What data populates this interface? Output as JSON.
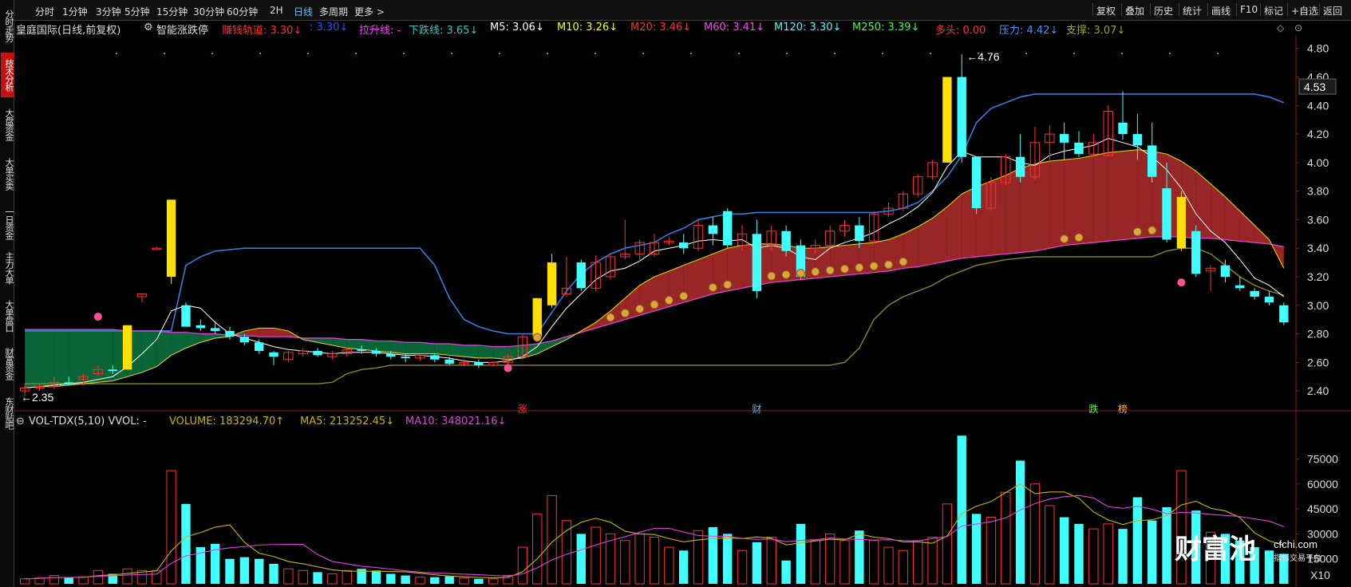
{
  "sidebar": {
    "tabs": [
      {
        "label": "分时走势",
        "active": false
      },
      {
        "label": "技术分析",
        "active": true
      },
      {
        "label": "大盘资金",
        "active": false
      },
      {
        "label": "大单买卖",
        "active": false
      },
      {
        "label": "一日资金",
        "active": false
      },
      {
        "label": "主力大单",
        "active": false
      },
      {
        "label": "大单盘口",
        "active": false
      },
      {
        "label": "财富资金",
        "active": false
      },
      {
        "label": "东财贴吧",
        "active": false
      }
    ]
  },
  "toolbar": {
    "periods": [
      "分时",
      "1分钟",
      "3分钟",
      "5分钟",
      "15分钟",
      "30分钟",
      "60分钟",
      "2H",
      "日线",
      "多周期",
      "更多 >"
    ],
    "active_period": "日线",
    "right_buttons": [
      "复权",
      "叠加",
      "历史",
      "统计",
      "画线",
      "F10",
      "标记",
      "+自选",
      "返回"
    ]
  },
  "main_legend": {
    "title": "皇庭国际(日线,前复权)",
    "indicator": "智能涨跌停",
    "items": [
      {
        "text": "赚钱轨道: 3.30↓",
        "color": "#ff3030"
      },
      {
        "text": ": 3.30↓",
        "color": "#3050ff"
      },
      {
        "text": "拉升线: -",
        "color": "#ff40ff"
      },
      {
        "text": "下跌线: 3.65↓",
        "color": "#40c0c0"
      },
      {
        "text": "M5: 3.06↓",
        "color": "#ffffff"
      },
      {
        "text": "M10: 3.26↓",
        "color": "#ffff00"
      },
      {
        "text": "M20: 3.46↓",
        "color": "#ff3030"
      },
      {
        "text": "M60: 3.41↓",
        "color": "#ff40ff"
      },
      {
        "text": "M120: 3.30↓",
        "color": "#40ffff"
      },
      {
        "text": "M250: 3.39↓",
        "color": "#40ff40"
      },
      {
        "text": "多头: 0.00",
        "color": "#ff3030"
      },
      {
        "text": "压力: 4.42↓",
        "color": "#4a90ff"
      },
      {
        "text": "支撑: 3.07↓",
        "color": "#a0a020"
      }
    ]
  },
  "price_axis": {
    "ticks": [
      "4.80",
      "4.60",
      "4.40",
      "4.20",
      "4.00",
      "3.80",
      "3.60",
      "3.40",
      "3.20",
      "3.00",
      "2.80",
      "2.60",
      "2.40"
    ],
    "current_price": "4.53",
    "high_label": "4.76",
    "low_label": "2.35"
  },
  "markers": {
    "up": "涨",
    "cai": "财",
    "down": "跌",
    "bang": "榜"
  },
  "volume_legend": {
    "title": "VOL-TDX(5,10) VVOL: -",
    "volume": "VOLUME: 183294.70↑",
    "ma5": "MA5: 213252.45↓",
    "ma10": "MA10: 348021.16↓"
  },
  "volume_axis": {
    "ticks": [
      "75000",
      "60000",
      "45000",
      "30000",
      "15000"
    ],
    "unit": "X10"
  },
  "watermark": {
    "brand": "财富池",
    "site": "cfchi.com",
    "tagline": "指标交易平台"
  },
  "colors": {
    "up": "#ff3030",
    "down": "#40ffff",
    "ribbon_up": "#a02828",
    "ribbon_down": "#0a6a3a",
    "resistance": "#3a7ae0",
    "support": "#8a8a20"
  },
  "chart_data": {
    "type": "candlestick",
    "candles": [
      {
        "o": 2.4,
        "h": 2.45,
        "l": 2.36,
        "c": 2.42,
        "v": 3000
      },
      {
        "o": 2.42,
        "h": 2.46,
        "l": 2.4,
        "c": 2.43,
        "v": 3500
      },
      {
        "o": 2.43,
        "h": 2.5,
        "l": 2.41,
        "c": 2.46,
        "v": 5000
      },
      {
        "o": 2.46,
        "h": 2.5,
        "l": 2.44,
        "c": 2.45,
        "v": 3800
      },
      {
        "o": 2.48,
        "h": 2.52,
        "l": 2.44,
        "c": 2.5,
        "v": 4200
      },
      {
        "o": 2.52,
        "h": 2.58,
        "l": 2.5,
        "c": 2.55,
        "v": 8000
      },
      {
        "o": 2.55,
        "h": 2.58,
        "l": 2.52,
        "c": 2.54,
        "v": 6000
      },
      {
        "o": 2.55,
        "h": 2.86,
        "l": 2.55,
        "c": 2.86,
        "v": 9000
      },
      {
        "o": 3.06,
        "h": 3.08,
        "l": 3.02,
        "c": 3.08,
        "v": 8000
      },
      {
        "o": 3.4,
        "h": 3.41,
        "l": 3.39,
        "c": 3.4,
        "v": 8000
      },
      {
        "o": 3.2,
        "h": 3.74,
        "l": 3.15,
        "c": 3.74,
        "v": 68000
      },
      {
        "o": 3.0,
        "h": 3.02,
        "l": 2.85,
        "c": 2.85,
        "v": 48000
      },
      {
        "o": 2.86,
        "h": 2.9,
        "l": 2.82,
        "c": 2.84,
        "v": 22000
      },
      {
        "o": 2.84,
        "h": 2.88,
        "l": 2.8,
        "c": 2.82,
        "v": 24000
      },
      {
        "o": 2.82,
        "h": 2.85,
        "l": 2.76,
        "c": 2.78,
        "v": 15000
      },
      {
        "o": 2.78,
        "h": 2.8,
        "l": 2.72,
        "c": 2.74,
        "v": 16000
      },
      {
        "o": 2.74,
        "h": 2.76,
        "l": 2.66,
        "c": 2.68,
        "v": 15000
      },
      {
        "o": 2.67,
        "h": 2.68,
        "l": 2.58,
        "c": 2.64,
        "v": 12000
      },
      {
        "o": 2.62,
        "h": 2.68,
        "l": 2.6,
        "c": 2.67,
        "v": 9000
      },
      {
        "o": 2.66,
        "h": 2.7,
        "l": 2.64,
        "c": 2.68,
        "v": 8000
      },
      {
        "o": 2.68,
        "h": 2.7,
        "l": 2.64,
        "c": 2.65,
        "v": 7000
      },
      {
        "o": 2.64,
        "h": 2.68,
        "l": 2.62,
        "c": 2.66,
        "v": 6000
      },
      {
        "o": 2.66,
        "h": 2.7,
        "l": 2.64,
        "c": 2.69,
        "v": 8000
      },
      {
        "o": 2.69,
        "h": 2.72,
        "l": 2.66,
        "c": 2.68,
        "v": 9000
      },
      {
        "o": 2.68,
        "h": 2.7,
        "l": 2.64,
        "c": 2.66,
        "v": 8000
      },
      {
        "o": 2.66,
        "h": 2.68,
        "l": 2.62,
        "c": 2.64,
        "v": 6000
      },
      {
        "o": 2.64,
        "h": 2.66,
        "l": 2.6,
        "c": 2.63,
        "v": 5000
      },
      {
        "o": 2.63,
        "h": 2.66,
        "l": 2.61,
        "c": 2.65,
        "v": 4000
      },
      {
        "o": 2.65,
        "h": 2.66,
        "l": 2.6,
        "c": 2.62,
        "v": 4000
      },
      {
        "o": 2.62,
        "h": 2.64,
        "l": 2.58,
        "c": 2.59,
        "v": 4500
      },
      {
        "o": 2.59,
        "h": 2.62,
        "l": 2.57,
        "c": 2.6,
        "v": 3500
      },
      {
        "o": 2.6,
        "h": 2.62,
        "l": 2.56,
        "c": 2.58,
        "v": 3000
      },
      {
        "o": 2.58,
        "h": 2.61,
        "l": 2.57,
        "c": 2.6,
        "v": 3000
      },
      {
        "o": 2.6,
        "h": 2.66,
        "l": 2.58,
        "c": 2.64,
        "v": 5000
      },
      {
        "o": 2.64,
        "h": 2.8,
        "l": 2.62,
        "c": 2.78,
        "v": 22000
      },
      {
        "o": 2.78,
        "h": 3.05,
        "l": 2.76,
        "c": 3.05,
        "v": 42000
      },
      {
        "o": 3.0,
        "h": 3.36,
        "l": 2.98,
        "c": 3.3,
        "v": 53000
      },
      {
        "o": 3.08,
        "h": 3.34,
        "l": 3.06,
        "c": 3.12,
        "v": 38000
      },
      {
        "o": 3.3,
        "h": 3.32,
        "l": 3.1,
        "c": 3.12,
        "v": 30000
      },
      {
        "o": 3.12,
        "h": 3.35,
        "l": 3.1,
        "c": 3.3,
        "v": 34000
      },
      {
        "o": 3.2,
        "h": 3.36,
        "l": 3.18,
        "c": 3.34,
        "v": 30000
      },
      {
        "o": 3.34,
        "h": 3.6,
        "l": 3.32,
        "c": 3.36,
        "v": 26000
      },
      {
        "o": 3.36,
        "h": 3.46,
        "l": 3.3,
        "c": 3.44,
        "v": 30000
      },
      {
        "o": 3.36,
        "h": 3.5,
        "l": 3.34,
        "c": 3.44,
        "v": 28000
      },
      {
        "o": 3.44,
        "h": 3.48,
        "l": 3.42,
        "c": 3.45,
        "v": 22000
      },
      {
        "o": 3.44,
        "h": 3.5,
        "l": 3.36,
        "c": 3.4,
        "v": 20000
      },
      {
        "o": 3.4,
        "h": 3.6,
        "l": 3.38,
        "c": 3.56,
        "v": 32000
      },
      {
        "o": 3.56,
        "h": 3.62,
        "l": 3.42,
        "c": 3.5,
        "v": 34000
      },
      {
        "o": 3.66,
        "h": 3.68,
        "l": 3.4,
        "c": 3.42,
        "v": 30000
      },
      {
        "o": 3.42,
        "h": 3.56,
        "l": 3.38,
        "c": 3.5,
        "v": 20000
      },
      {
        "o": 3.5,
        "h": 3.6,
        "l": 3.05,
        "c": 3.1,
        "v": 25000
      },
      {
        "o": 3.42,
        "h": 3.56,
        "l": 3.38,
        "c": 3.52,
        "v": 28000
      },
      {
        "o": 3.52,
        "h": 3.56,
        "l": 3.34,
        "c": 3.38,
        "v": 14000
      },
      {
        "o": 3.42,
        "h": 3.46,
        "l": 3.18,
        "c": 3.2,
        "v": 36000
      },
      {
        "o": 3.4,
        "h": 3.46,
        "l": 3.36,
        "c": 3.42,
        "v": 26000
      },
      {
        "o": 3.42,
        "h": 3.56,
        "l": 3.4,
        "c": 3.52,
        "v": 30000
      },
      {
        "o": 3.52,
        "h": 3.6,
        "l": 3.48,
        "c": 3.56,
        "v": 26000
      },
      {
        "o": 3.56,
        "h": 3.62,
        "l": 3.4,
        "c": 3.45,
        "v": 32000
      },
      {
        "o": 3.45,
        "h": 3.66,
        "l": 3.44,
        "c": 3.64,
        "v": 26000
      },
      {
        "o": 3.64,
        "h": 3.72,
        "l": 3.62,
        "c": 3.68,
        "v": 22000
      },
      {
        "o": 3.68,
        "h": 3.8,
        "l": 3.66,
        "c": 3.78,
        "v": 20000
      },
      {
        "o": 3.78,
        "h": 3.92,
        "l": 3.76,
        "c": 3.9,
        "v": 26000
      },
      {
        "o": 3.9,
        "h": 4.02,
        "l": 3.88,
        "c": 4.0,
        "v": 28000
      },
      {
        "o": 4.0,
        "h": 4.6,
        "l": 4.0,
        "c": 4.6,
        "v": 48000
      },
      {
        "o": 4.6,
        "h": 4.76,
        "l": 4.0,
        "c": 4.04,
        "v": 89000
      },
      {
        "o": 4.04,
        "h": 4.04,
        "l": 3.64,
        "c": 3.68,
        "v": 42000
      },
      {
        "o": 3.68,
        "h": 3.9,
        "l": 3.66,
        "c": 3.86,
        "v": 40000
      },
      {
        "o": 3.86,
        "h": 4.06,
        "l": 3.84,
        "c": 4.04,
        "v": 55000
      },
      {
        "o": 4.04,
        "h": 4.2,
        "l": 3.86,
        "c": 3.9,
        "v": 74000
      },
      {
        "o": 3.9,
        "h": 4.25,
        "l": 3.88,
        "c": 4.14,
        "v": 60000
      },
      {
        "o": 4.14,
        "h": 4.26,
        "l": 4.0,
        "c": 4.2,
        "v": 47000
      },
      {
        "o": 4.2,
        "h": 4.28,
        "l": 4.02,
        "c": 4.14,
        "v": 40000
      },
      {
        "o": 4.14,
        "h": 4.22,
        "l": 4.04,
        "c": 4.06,
        "v": 36000
      },
      {
        "o": 4.06,
        "h": 4.2,
        "l": 4.04,
        "c": 4.14,
        "v": 33000
      },
      {
        "o": 4.05,
        "h": 4.4,
        "l": 4.04,
        "c": 4.36,
        "v": 36000
      },
      {
        "o": 4.28,
        "h": 4.5,
        "l": 4.16,
        "c": 4.2,
        "v": 33000
      },
      {
        "o": 4.2,
        "h": 4.34,
        "l": 4.02,
        "c": 4.12,
        "v": 52000
      },
      {
        "o": 4.12,
        "h": 4.28,
        "l": 3.86,
        "c": 3.9,
        "v": 38000
      },
      {
        "o": 3.82,
        "h": 4.0,
        "l": 3.44,
        "c": 3.46,
        "v": 46000
      },
      {
        "o": 3.4,
        "h": 3.8,
        "l": 3.38,
        "c": 3.76,
        "v": 68000
      },
      {
        "o": 3.52,
        "h": 3.56,
        "l": 3.2,
        "c": 3.22,
        "v": 44000
      },
      {
        "o": 3.24,
        "h": 3.28,
        "l": 3.1,
        "c": 3.26,
        "v": 31000
      },
      {
        "o": 3.28,
        "h": 3.32,
        "l": 3.16,
        "c": 3.2,
        "v": 30000
      },
      {
        "o": 3.14,
        "h": 3.2,
        "l": 3.1,
        "c": 3.12,
        "v": 26000
      },
      {
        "o": 3.1,
        "h": 3.12,
        "l": 3.04,
        "c": 3.06,
        "v": 22000
      },
      {
        "o": 3.06,
        "h": 3.1,
        "l": 3.0,
        "c": 3.02,
        "v": 20000
      },
      {
        "o": 3.0,
        "h": 3.02,
        "l": 2.86,
        "c": 2.88,
        "v": 18000
      }
    ],
    "ylim": [
      2.3,
      4.86
    ],
    "vol_ylim": [
      0,
      92000
    ],
    "moving_averages": {
      "m5": [
        2.42,
        2.43,
        2.44,
        2.45,
        2.46,
        2.48,
        2.5,
        2.57,
        2.66,
        2.76,
        2.96,
        3.0,
        2.98,
        2.88,
        2.8,
        2.77,
        2.74,
        2.71,
        2.69,
        2.68,
        2.67,
        2.66,
        2.67,
        2.67,
        2.67,
        2.66,
        2.65,
        2.65,
        2.64,
        2.63,
        2.61,
        2.6,
        2.6,
        2.61,
        2.64,
        2.71,
        2.85,
        2.98,
        3.08,
        3.18,
        3.24,
        3.26,
        3.31,
        3.38,
        3.4,
        3.42,
        3.45,
        3.46,
        3.45,
        3.46,
        3.4,
        3.42,
        3.4,
        3.34,
        3.32,
        3.4,
        3.44,
        3.47,
        3.51,
        3.57,
        3.62,
        3.69,
        3.79,
        3.97,
        4.08,
        4.04,
        4.04,
        4.04,
        4.0,
        3.98,
        4.05,
        4.08,
        4.1,
        4.12,
        4.17,
        4.14,
        4.11,
        4.04,
        3.95,
        3.82,
        3.64,
        3.52,
        3.44,
        3.32,
        3.19,
        3.14,
        3.06
      ],
      "m10": [
        2.42,
        2.43,
        2.43,
        2.44,
        2.45,
        2.46,
        2.47,
        2.5,
        2.53,
        2.57,
        2.65,
        2.7,
        2.74,
        2.77,
        2.78,
        2.82,
        2.84,
        2.84,
        2.82,
        2.76,
        2.74,
        2.72,
        2.7,
        2.69,
        2.68,
        2.67,
        2.66,
        2.66,
        2.66,
        2.65,
        2.64,
        2.63,
        2.63,
        2.62,
        2.63,
        2.66,
        2.71,
        2.76,
        2.82,
        2.88,
        2.96,
        3.05,
        3.14,
        3.2,
        3.24,
        3.28,
        3.32,
        3.36,
        3.4,
        3.42,
        3.43,
        3.43,
        3.42,
        3.4,
        3.4,
        3.41,
        3.42,
        3.43,
        3.44,
        3.46,
        3.5,
        3.55,
        3.61,
        3.69,
        3.78,
        3.83,
        3.87,
        3.91,
        3.96,
        3.99,
        4.01,
        4.02,
        4.03,
        4.05,
        4.07,
        4.08,
        4.09,
        4.08,
        4.06,
        4.01,
        3.94,
        3.85,
        3.76,
        3.66,
        3.56,
        3.46,
        3.26
      ],
      "m60": [
        2.83,
        2.83,
        2.83,
        2.83,
        2.83,
        2.83,
        2.83,
        2.82,
        2.82,
        2.82,
        2.81,
        2.81,
        2.8,
        2.8,
        2.79,
        2.79,
        2.78,
        2.78,
        2.78,
        2.77,
        2.77,
        2.77,
        2.76,
        2.76,
        2.75,
        2.75,
        2.74,
        2.74,
        2.73,
        2.73,
        2.72,
        2.72,
        2.71,
        2.71,
        2.72,
        2.73,
        2.75,
        2.78,
        2.81,
        2.84,
        2.87,
        2.9,
        2.93,
        2.96,
        2.99,
        3.02,
        3.05,
        3.08,
        3.1,
        3.12,
        3.14,
        3.16,
        3.17,
        3.18,
        3.19,
        3.2,
        3.21,
        3.22,
        3.23,
        3.24,
        3.26,
        3.27,
        3.29,
        3.31,
        3.33,
        3.34,
        3.35,
        3.36,
        3.37,
        3.38,
        3.4,
        3.42,
        3.43,
        3.44,
        3.45,
        3.46,
        3.47,
        3.48,
        3.48,
        3.48,
        3.47,
        3.47,
        3.46,
        3.45,
        3.44,
        3.43,
        3.41
      ],
      "resistance": [
        2.82,
        2.82,
        2.82,
        2.82,
        2.82,
        2.82,
        2.82,
        2.82,
        2.82,
        2.82,
        2.82,
        3.28,
        3.34,
        3.38,
        3.39,
        3.4,
        3.4,
        3.4,
        3.4,
        3.4,
        3.4,
        3.4,
        3.4,
        3.4,
        3.4,
        3.4,
        3.4,
        3.4,
        3.28,
        3.05,
        2.9,
        2.85,
        2.82,
        2.8,
        2.8,
        2.8,
        2.95,
        3.1,
        3.22,
        3.3,
        3.36,
        3.4,
        3.42,
        3.44,
        3.5,
        3.54,
        3.6,
        3.62,
        3.64,
        3.64,
        3.65,
        3.65,
        3.65,
        3.65,
        3.65,
        3.65,
        3.65,
        3.65,
        3.65,
        3.66,
        3.68,
        3.72,
        3.8,
        3.9,
        4.05,
        4.28,
        4.38,
        4.42,
        4.46,
        4.48,
        4.48,
        4.48,
        4.48,
        4.48,
        4.48,
        4.48,
        4.48,
        4.48,
        4.48,
        4.48,
        4.48,
        4.48,
        4.48,
        4.48,
        4.48,
        4.46,
        4.42
      ],
      "support": [
        2.45,
        2.45,
        2.45,
        2.45,
        2.45,
        2.45,
        2.45,
        2.45,
        2.45,
        2.45,
        2.45,
        2.45,
        2.45,
        2.45,
        2.45,
        2.45,
        2.45,
        2.45,
        2.45,
        2.45,
        2.45,
        2.46,
        2.52,
        2.55,
        2.56,
        2.58,
        2.58,
        2.58,
        2.58,
        2.58,
        2.58,
        2.58,
        2.58,
        2.58,
        2.58,
        2.58,
        2.58,
        2.58,
        2.58,
        2.58,
        2.58,
        2.58,
        2.58,
        2.58,
        2.58,
        2.58,
        2.58,
        2.58,
        2.58,
        2.58,
        2.58,
        2.58,
        2.58,
        2.58,
        2.58,
        2.58,
        2.6,
        2.7,
        2.9,
        3.0,
        3.06,
        3.1,
        3.14,
        3.2,
        3.24,
        3.28,
        3.3,
        3.32,
        3.33,
        3.34,
        3.34,
        3.34,
        3.34,
        3.34,
        3.34,
        3.34,
        3.34,
        3.34,
        3.38,
        3.4,
        3.4,
        3.36,
        3.28,
        3.2,
        3.14,
        3.1,
        3.07
      ]
    }
  }
}
